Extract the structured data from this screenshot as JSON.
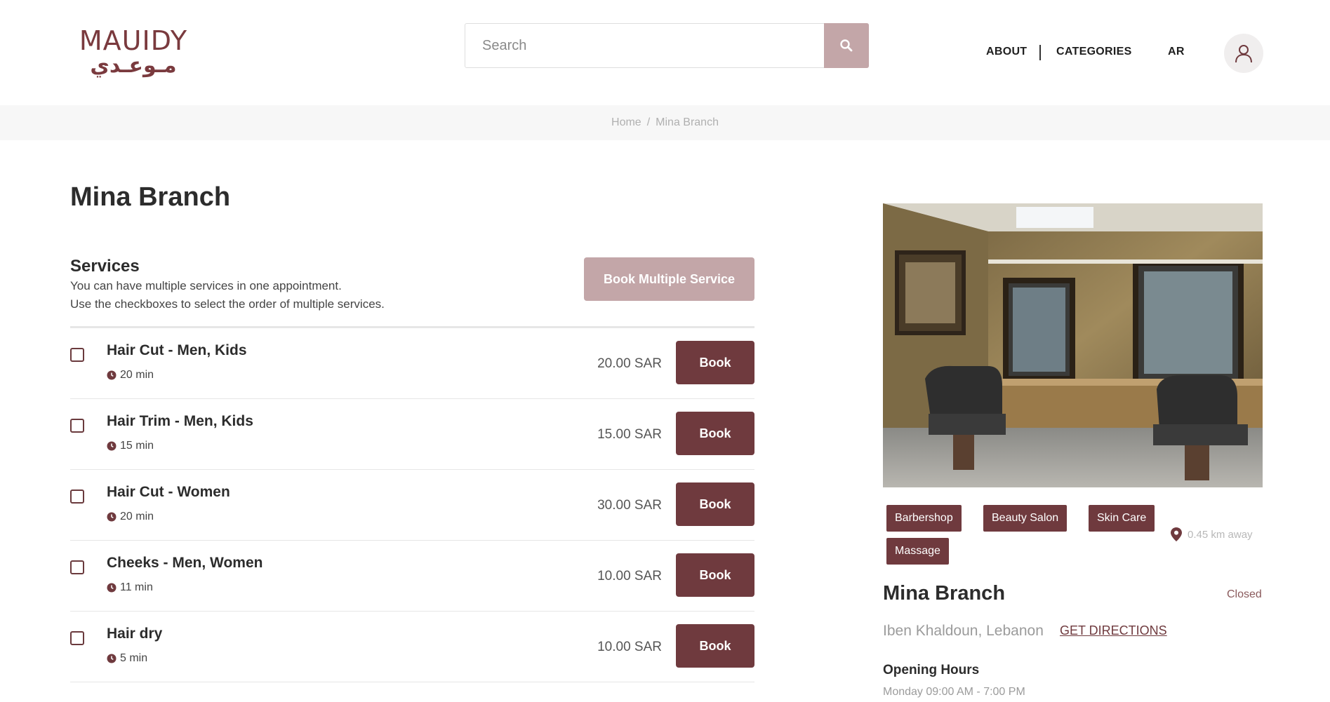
{
  "header": {
    "logo_latin": "MAUIDY",
    "logo_arabic": "مـوعـدي",
    "search_placeholder": "Search",
    "nav": {
      "about": "ABOUT",
      "categories": "CATEGORIES",
      "lang": "AR"
    },
    "icons": {
      "search": "search-icon",
      "user": "user-icon"
    }
  },
  "breadcrumb": {
    "home": "Home",
    "separator": "/",
    "current": "Mina Branch"
  },
  "main": {
    "title": "Mina Branch",
    "services_heading": "Services",
    "services_desc_1": "You can have multiple services in one appointment.",
    "services_desc_2": "Use the checkboxes to select the order of multiple services.",
    "multi_button": "Book Multiple Service",
    "book_label": "Book",
    "services": [
      {
        "name": "Hair Cut - Men, Kids",
        "duration": "20 min",
        "price": "20.00 SAR"
      },
      {
        "name": "Hair Trim - Men, Kids",
        "duration": "15 min",
        "price": "15.00 SAR"
      },
      {
        "name": "Hair Cut - Women",
        "duration": "20 min",
        "price": "30.00 SAR"
      },
      {
        "name": "Cheeks - Men, Women",
        "duration": "11 min",
        "price": "10.00 SAR"
      },
      {
        "name": "Hair dry",
        "duration": "5 min",
        "price": "10.00 SAR"
      }
    ]
  },
  "sidebar": {
    "tags": [
      "Barbershop",
      "Beauty Salon",
      "Skin Care",
      "Massage"
    ],
    "distance": "0.45 km away",
    "title": "Mina Branch",
    "status": "Closed",
    "address": "Iben Khaldoun, Lebanon",
    "directions": "GET DIRECTIONS",
    "hours_title": "Opening Hours",
    "hours_line": "Monday 09:00 AM - 7:00 PM"
  },
  "colors": {
    "brand": "#6f3a3e",
    "brand_light": "#c3a6a8",
    "breadcrumb_bg": "#f7f7f7"
  }
}
